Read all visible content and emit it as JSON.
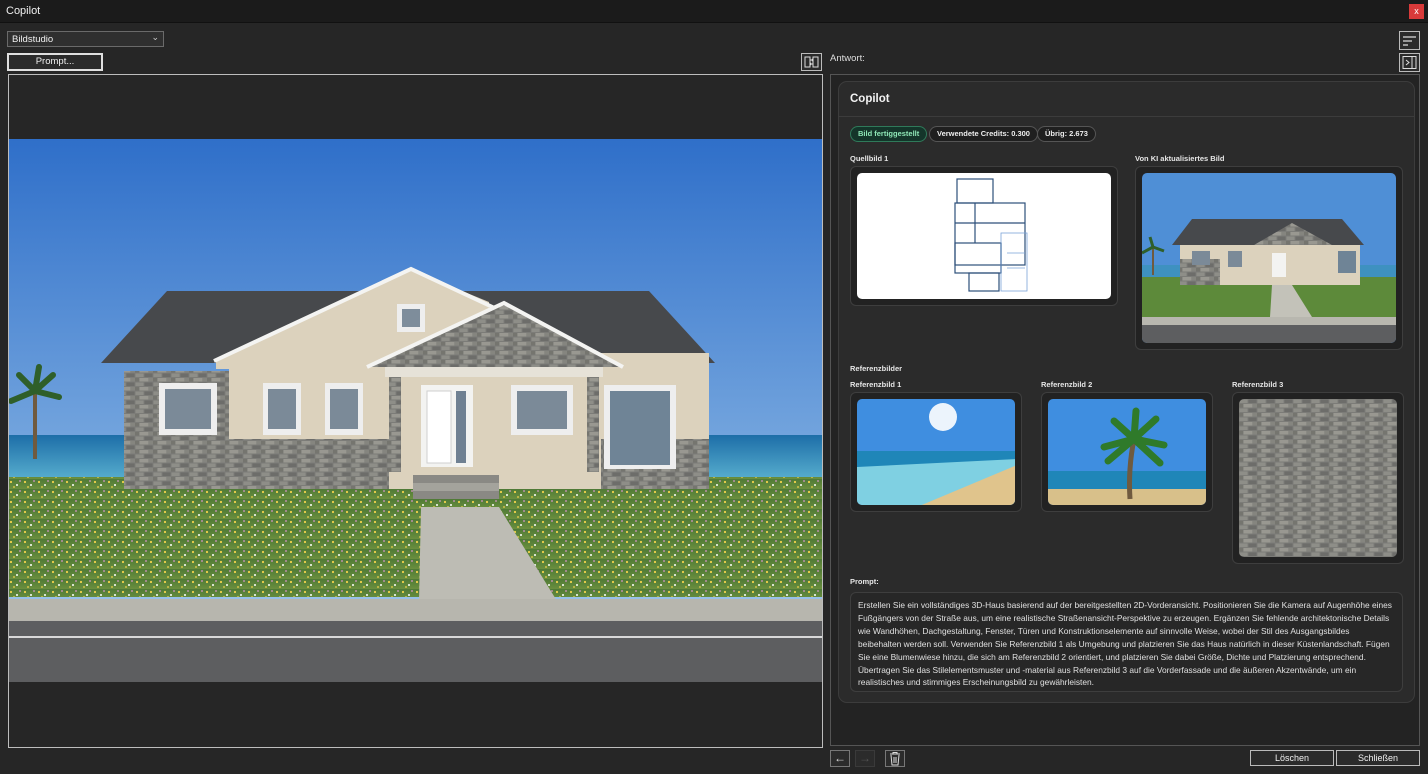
{
  "window": {
    "title": "Copilot",
    "close_glyph": "x"
  },
  "toolbar": {
    "mode_value": "Bildstudio",
    "prompt_button": "Prompt..."
  },
  "answer": {
    "label": "Antwort:",
    "card_title": "Copilot",
    "status_badge": "Bild fertiggestellt",
    "credits_badge": "Verwendete Credits: 0.300",
    "remaining_badge": "Übrig: 2.673",
    "source_label": "Quellbild 1",
    "updated_label": "Von KI aktualisiertes Bild",
    "references_heading": "Referenzbilder",
    "references": [
      "Referenzbild 1",
      "Referenzbild 2",
      "Referenzbild 3"
    ],
    "prompt_heading": "Prompt:",
    "prompt_text": "Erstellen Sie ein vollständiges 3D-Haus basierend auf der bereitgestellten 2D-Vorderansicht. Positionieren Sie die Kamera auf Augenhöhe eines Fußgängers von der Straße aus, um eine realistische Straßenansicht-Perspektive zu erzeugen. Ergänzen Sie fehlende architektonische Details wie Wandhöhen, Dachgestaltung, Fenster, Türen und Konstruktionselemente auf sinnvolle Weise, wobei der Stil des Ausgangsbildes beibehalten werden soll. Verwenden Sie Referenzbild 1 als Umgebung und platzieren Sie das Haus natürlich in dieser Küstenlandschaft. Fügen Sie eine Blumenwiese hinzu, die sich am Referenzbild 2 orientiert, und platzieren Sie dabei Größe, Dichte und Platzierung entsprechend. Übertragen Sie das Stilelementsmuster und -material aus Referenzbild 3 auf die Vorderfassade und die äußeren Akzentwände, um ein realistisches und stimmiges Erscheinungsbild zu gewährleisten."
  },
  "footer": {
    "delete_button": "Löschen",
    "close_button": "Schließen",
    "back_glyph": "←",
    "forward_glyph": "→"
  },
  "icons": [
    "chevron-down-icon",
    "swap-panels-icon",
    "sort-lines-icon",
    "collapse-panel-icon",
    "arrow-left-icon",
    "arrow-right-icon",
    "trash-icon",
    "close-icon"
  ]
}
